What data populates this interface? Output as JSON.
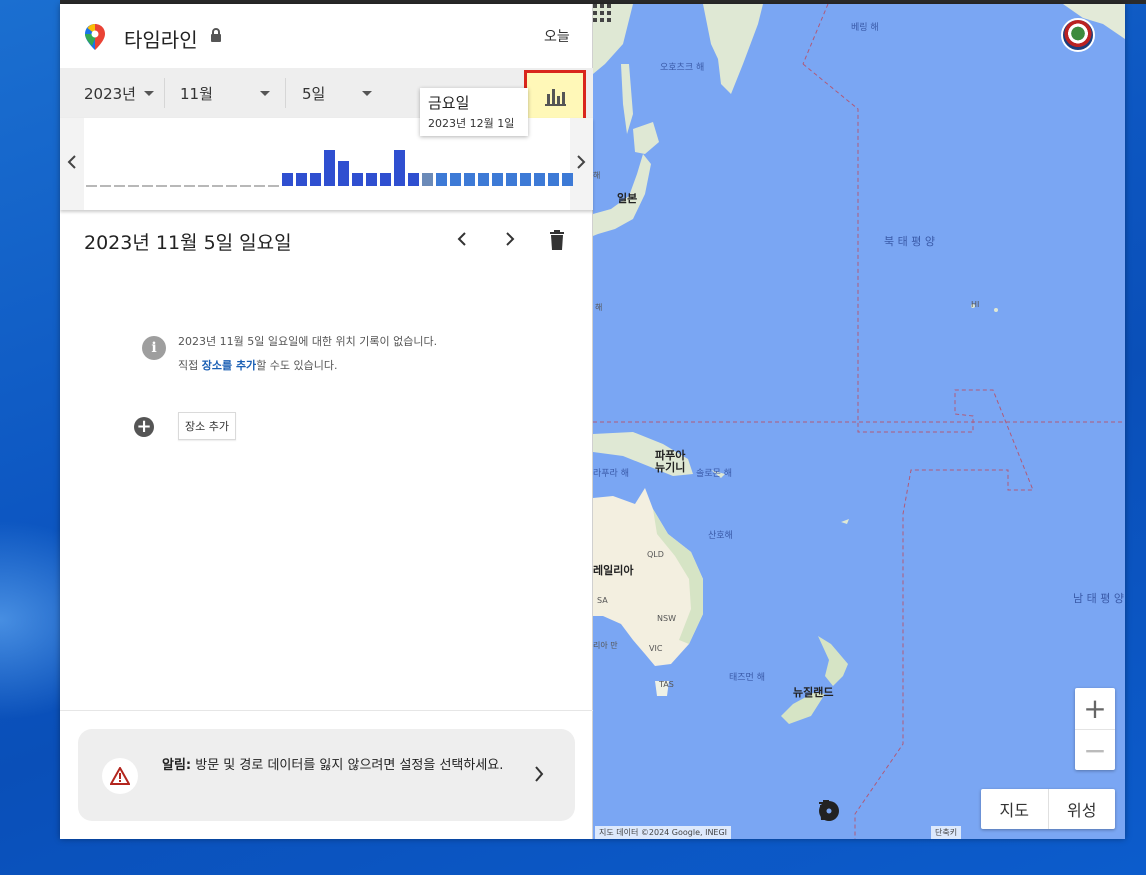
{
  "header": {
    "title": "타임라인",
    "today_label": "오늘"
  },
  "selectors": {
    "year": "2023년",
    "month": "11월",
    "day": "5일"
  },
  "tooltip": {
    "day": "금요일",
    "date": "2023년 12월 1일"
  },
  "histogram": {
    "gray_days": 14,
    "bars": [
      {
        "h": 0.35,
        "c": "#2f4fd0"
      },
      {
        "h": 0.35,
        "c": "#2f4fd0"
      },
      {
        "h": 0.35,
        "c": "#2f4fd0"
      },
      {
        "h": 1.0,
        "c": "#2f4fd0"
      },
      {
        "h": 0.7,
        "c": "#2f4fd0"
      },
      {
        "h": 0.35,
        "c": "#2f4fd0"
      },
      {
        "h": 0.35,
        "c": "#2f4fd0"
      },
      {
        "h": 0.35,
        "c": "#2f4fd0"
      },
      {
        "h": 1.0,
        "c": "#2f4fd0"
      },
      {
        "h": 0.35,
        "c": "#2f4fd0"
      },
      {
        "h": 0.35,
        "c": "#6b8ab8"
      },
      {
        "h": 0.35,
        "c": "#3d7ad6"
      },
      {
        "h": 0.35,
        "c": "#3d7ad6"
      },
      {
        "h": 0.35,
        "c": "#3d7ad6"
      },
      {
        "h": 0.35,
        "c": "#3d7ad6"
      },
      {
        "h": 0.35,
        "c": "#3d7ad6"
      },
      {
        "h": 0.35,
        "c": "#3d7ad6"
      },
      {
        "h": 0.35,
        "c": "#3d7ad6"
      },
      {
        "h": 0.35,
        "c": "#3d7ad6"
      },
      {
        "h": 0.35,
        "c": "#3d7ad6"
      },
      {
        "h": 0.35,
        "c": "#3d7ad6"
      }
    ]
  },
  "day_view": {
    "date_title": "2023년 11월 5일 일요일",
    "empty_line1": "2023년 11월 5일 일요일에 대한 위치 기록이 없습니다.",
    "empty_line2_prefix": "직접 ",
    "empty_line2_link": "장소를 추가",
    "empty_line2_suffix": "할 수도 있습니다.",
    "add_place_label": "장소 추가"
  },
  "alert": {
    "bold": "알림:",
    "text": " 방문 및 경로 데이터를 잃지 않으려면 설정을 선택하세요."
  },
  "map": {
    "labels": {
      "bering": "베링 해",
      "okhotsk": "오호츠크 해",
      "japan": "일본",
      "north_pacific": "북 태 평 양",
      "hi": "HI",
      "png": "파푸아\n뉴기니",
      "arafura": "라푸라 해",
      "solomon": "솔로몬 해",
      "coral": "산호해",
      "australia": "레일리아",
      "qld": "QLD",
      "sa": "SA",
      "nsw": "NSW",
      "vic": "VIC",
      "bay": "리아 만",
      "tas": "TAS",
      "tasman": "태즈먼 해",
      "nz": "뉴질랜드",
      "south_pacific": "남 태 평 양",
      "sea1": "해",
      "sea2": "해"
    },
    "attribution": "지도 데이터 ©2024 Google, INEGI",
    "shortcuts": "단축키",
    "map_type": "지도",
    "satellite": "위성",
    "zoom_in": "+",
    "zoom_out": "−"
  },
  "colors": {
    "accent_red": "#d9261c",
    "highlight": "#fff8b8",
    "ocean": "#7aa6f3",
    "land": "#f3efe0"
  }
}
